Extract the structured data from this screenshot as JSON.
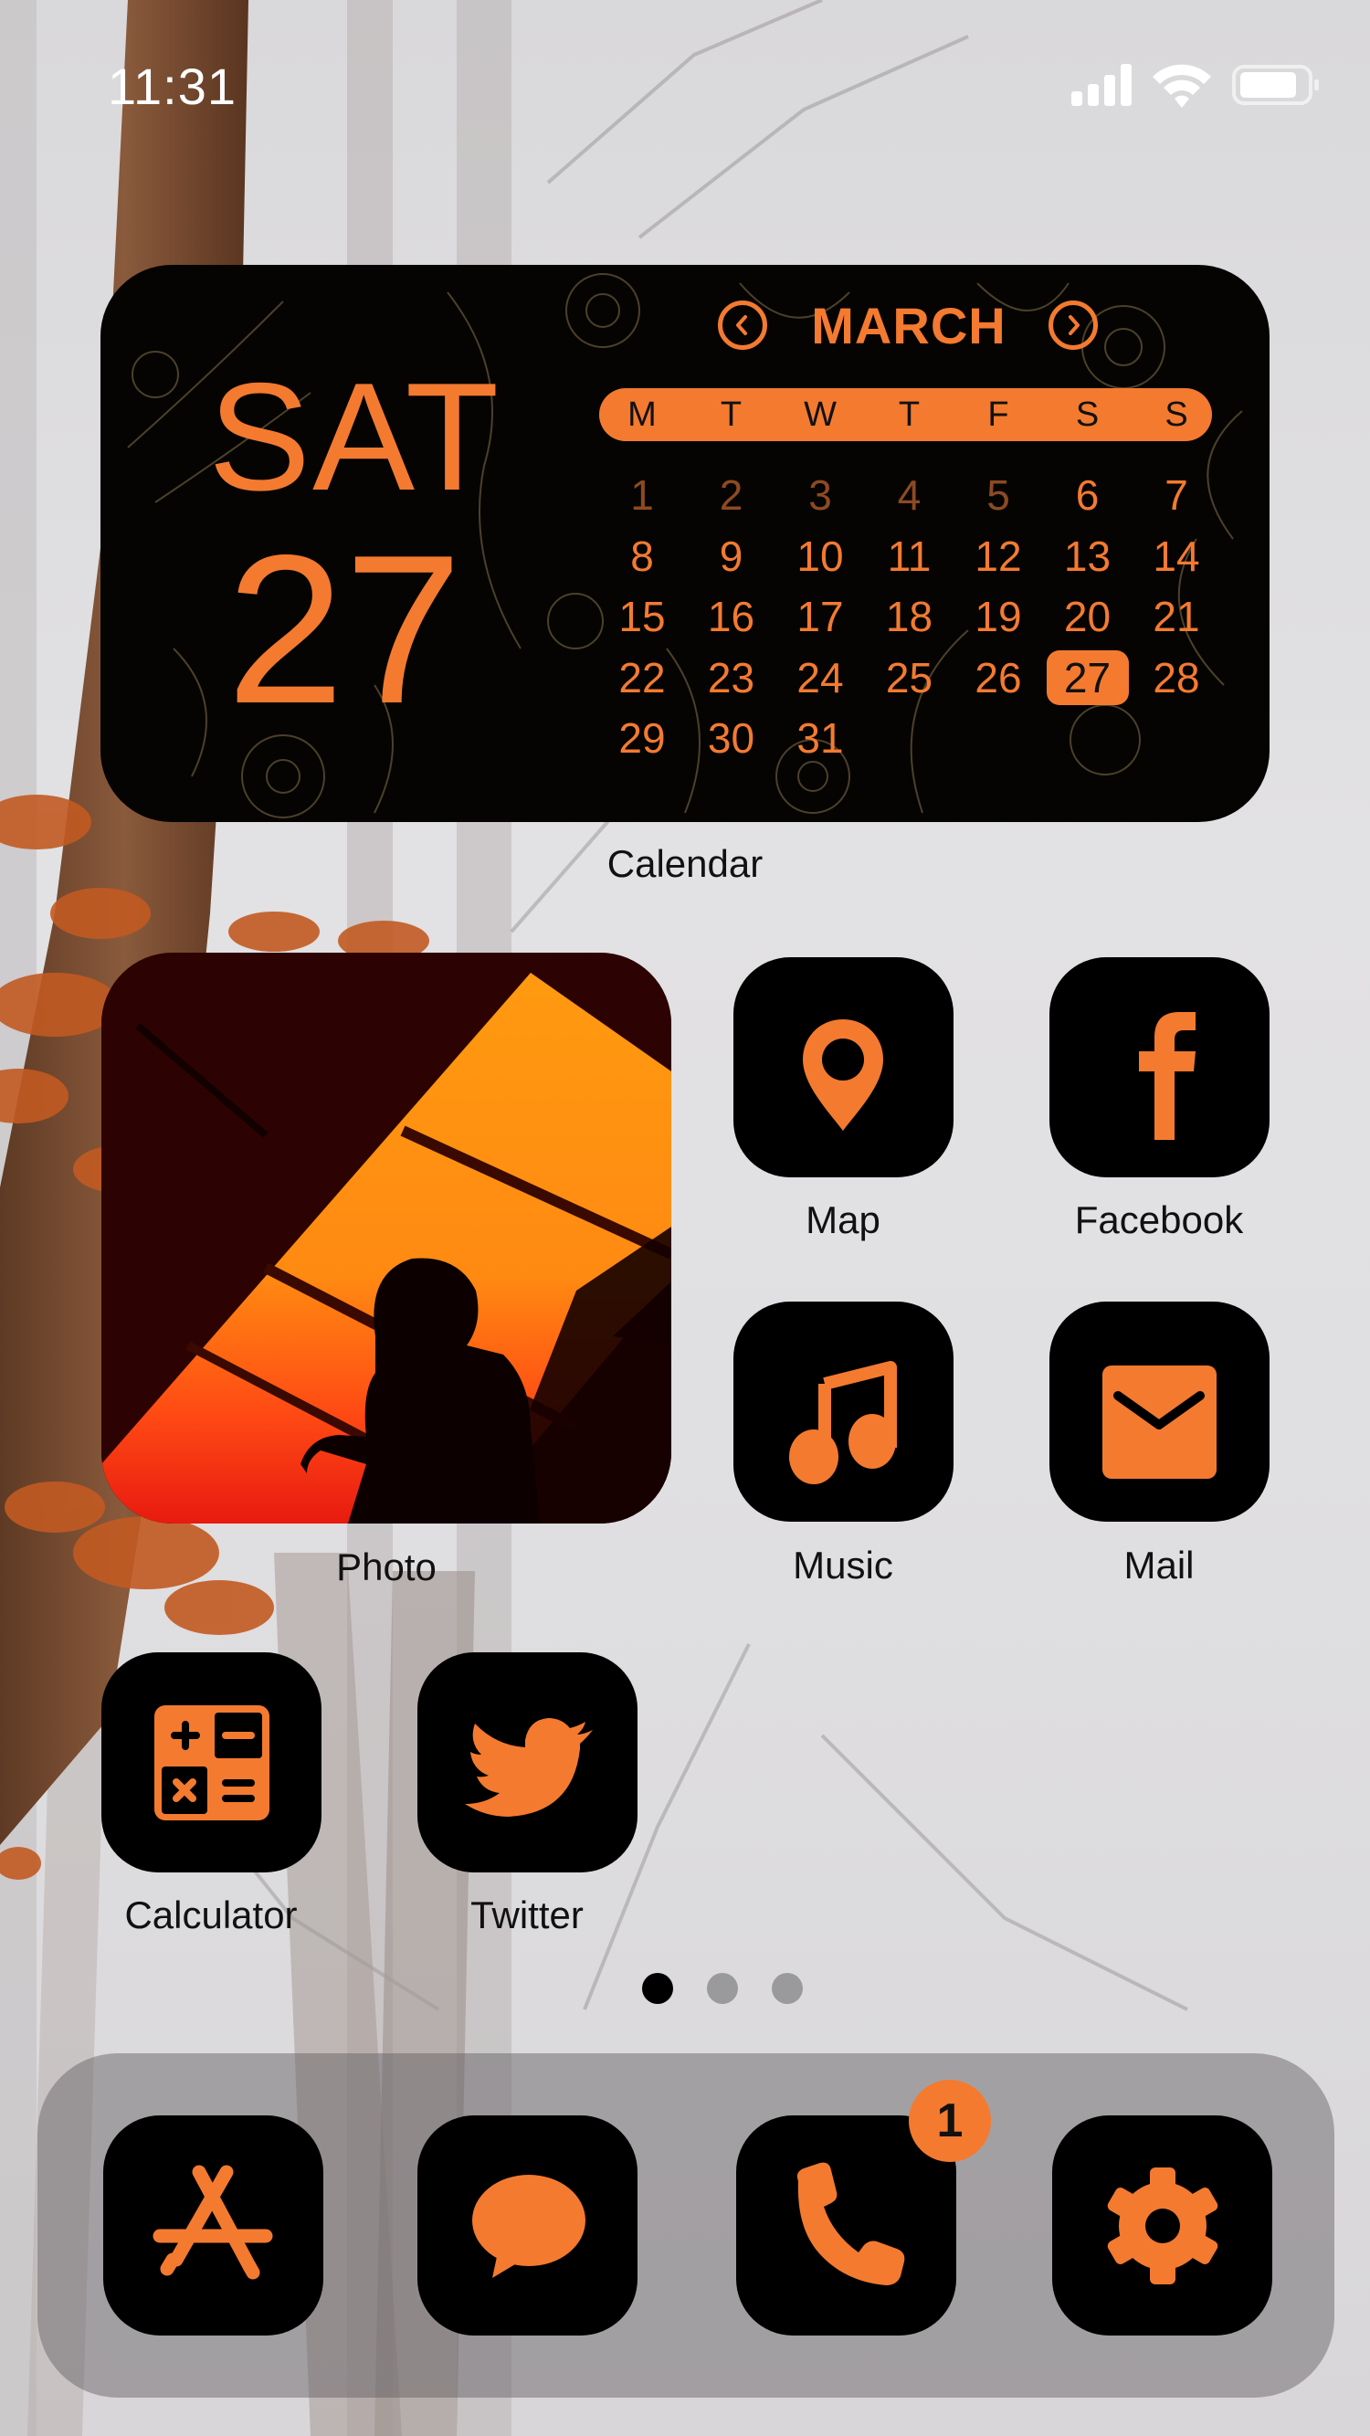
{
  "status_bar": {
    "time": "11:31",
    "signal_icon": "cellular-signal-icon",
    "wifi_icon": "wifi-icon",
    "battery_icon": "battery-icon",
    "battery_level": 0.85
  },
  "theme": {
    "accent": "#F47A30",
    "accent_dim": "#8D4A22",
    "icon_background": "#000000",
    "label_color": "#111111"
  },
  "calendar_widget": {
    "day_of_week": "SAT",
    "date": "27",
    "month": "MARCH",
    "prev_icon": "chevron-left-circle-icon",
    "next_icon": "chevron-right-circle-icon",
    "weekdays": [
      "M",
      "T",
      "W",
      "T",
      "F",
      "S",
      "S"
    ],
    "weeks": [
      [
        "1",
        "2",
        "3",
        "4",
        "5",
        "6",
        "7"
      ],
      [
        "8",
        "9",
        "10",
        "11",
        "12",
        "13",
        "14"
      ],
      [
        "15",
        "16",
        "17",
        "18",
        "19",
        "20",
        "21"
      ],
      [
        "22",
        "23",
        "24",
        "25",
        "26",
        "27",
        "28"
      ],
      [
        "29",
        "30",
        "31",
        "",
        "",
        "",
        ""
      ]
    ],
    "dimmed_days": [
      "1",
      "2",
      "3",
      "4",
      "5"
    ],
    "today": "27",
    "label": "Calendar"
  },
  "photo_widget": {
    "label": "Photo"
  },
  "apps": [
    {
      "name": "Map",
      "icon": "map-pin-icon"
    },
    {
      "name": "Facebook",
      "icon": "facebook-icon"
    },
    {
      "name": "Music",
      "icon": "music-note-icon"
    },
    {
      "name": "Mail",
      "icon": "mail-envelope-icon"
    },
    {
      "name": "Calculator",
      "icon": "calculator-icon"
    },
    {
      "name": "Twitter",
      "icon": "twitter-bird-icon"
    }
  ],
  "page_indicator": {
    "count": 3,
    "current": 1,
    "active_color": "#000000",
    "inactive_color": "#9a999b"
  },
  "dock": {
    "apps": [
      {
        "name": "App Store",
        "icon": "app-store-icon"
      },
      {
        "name": "Messages",
        "icon": "message-bubble-icon"
      },
      {
        "name": "Phone",
        "icon": "phone-icon",
        "badge": "1"
      },
      {
        "name": "Settings",
        "icon": "gear-icon"
      }
    ]
  }
}
